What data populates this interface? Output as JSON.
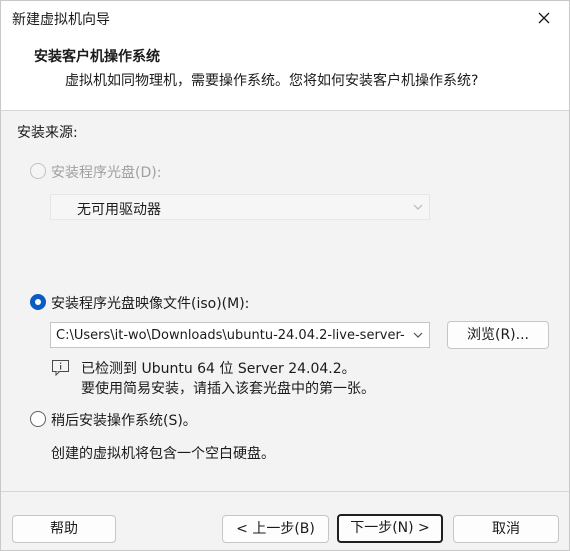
{
  "window": {
    "title": "新建虚拟机向导"
  },
  "header": {
    "title": "安装客户机操作系统",
    "subtitle": "虚拟机如同物理机，需要操作系统。您将如何安装客户机操作系统?"
  },
  "install_source": {
    "label": "安装来源:",
    "disc_option": {
      "label": "安装程序光盘(D):",
      "selected": false,
      "enabled": false
    },
    "disc_drive": {
      "value": "无可用驱动器",
      "enabled": false
    },
    "iso_option": {
      "label": "安装程序光盘映像文件(iso)(M):",
      "selected": true,
      "enabled": true
    },
    "iso_path": {
      "value": "C:\\Users\\it-wo\\Downloads\\ubuntu-24.04.2-live-server-"
    },
    "browse_label": "浏览(R)...",
    "detect_info": {
      "line1": "已检测到 Ubuntu 64 位 Server 24.04.2。",
      "line2": "要使用简易安装，请插入该套光盘中的第一张。"
    },
    "later_option": {
      "label": "稍后安装操作系统(S)。",
      "selected": false,
      "enabled": true
    },
    "later_note": "创建的虚拟机将包含一个空白硬盘。"
  },
  "footer": {
    "help_label": "帮助",
    "back_label": "< 上一步(B)",
    "next_label": "下一步(N) >",
    "cancel_label": "取消"
  }
}
